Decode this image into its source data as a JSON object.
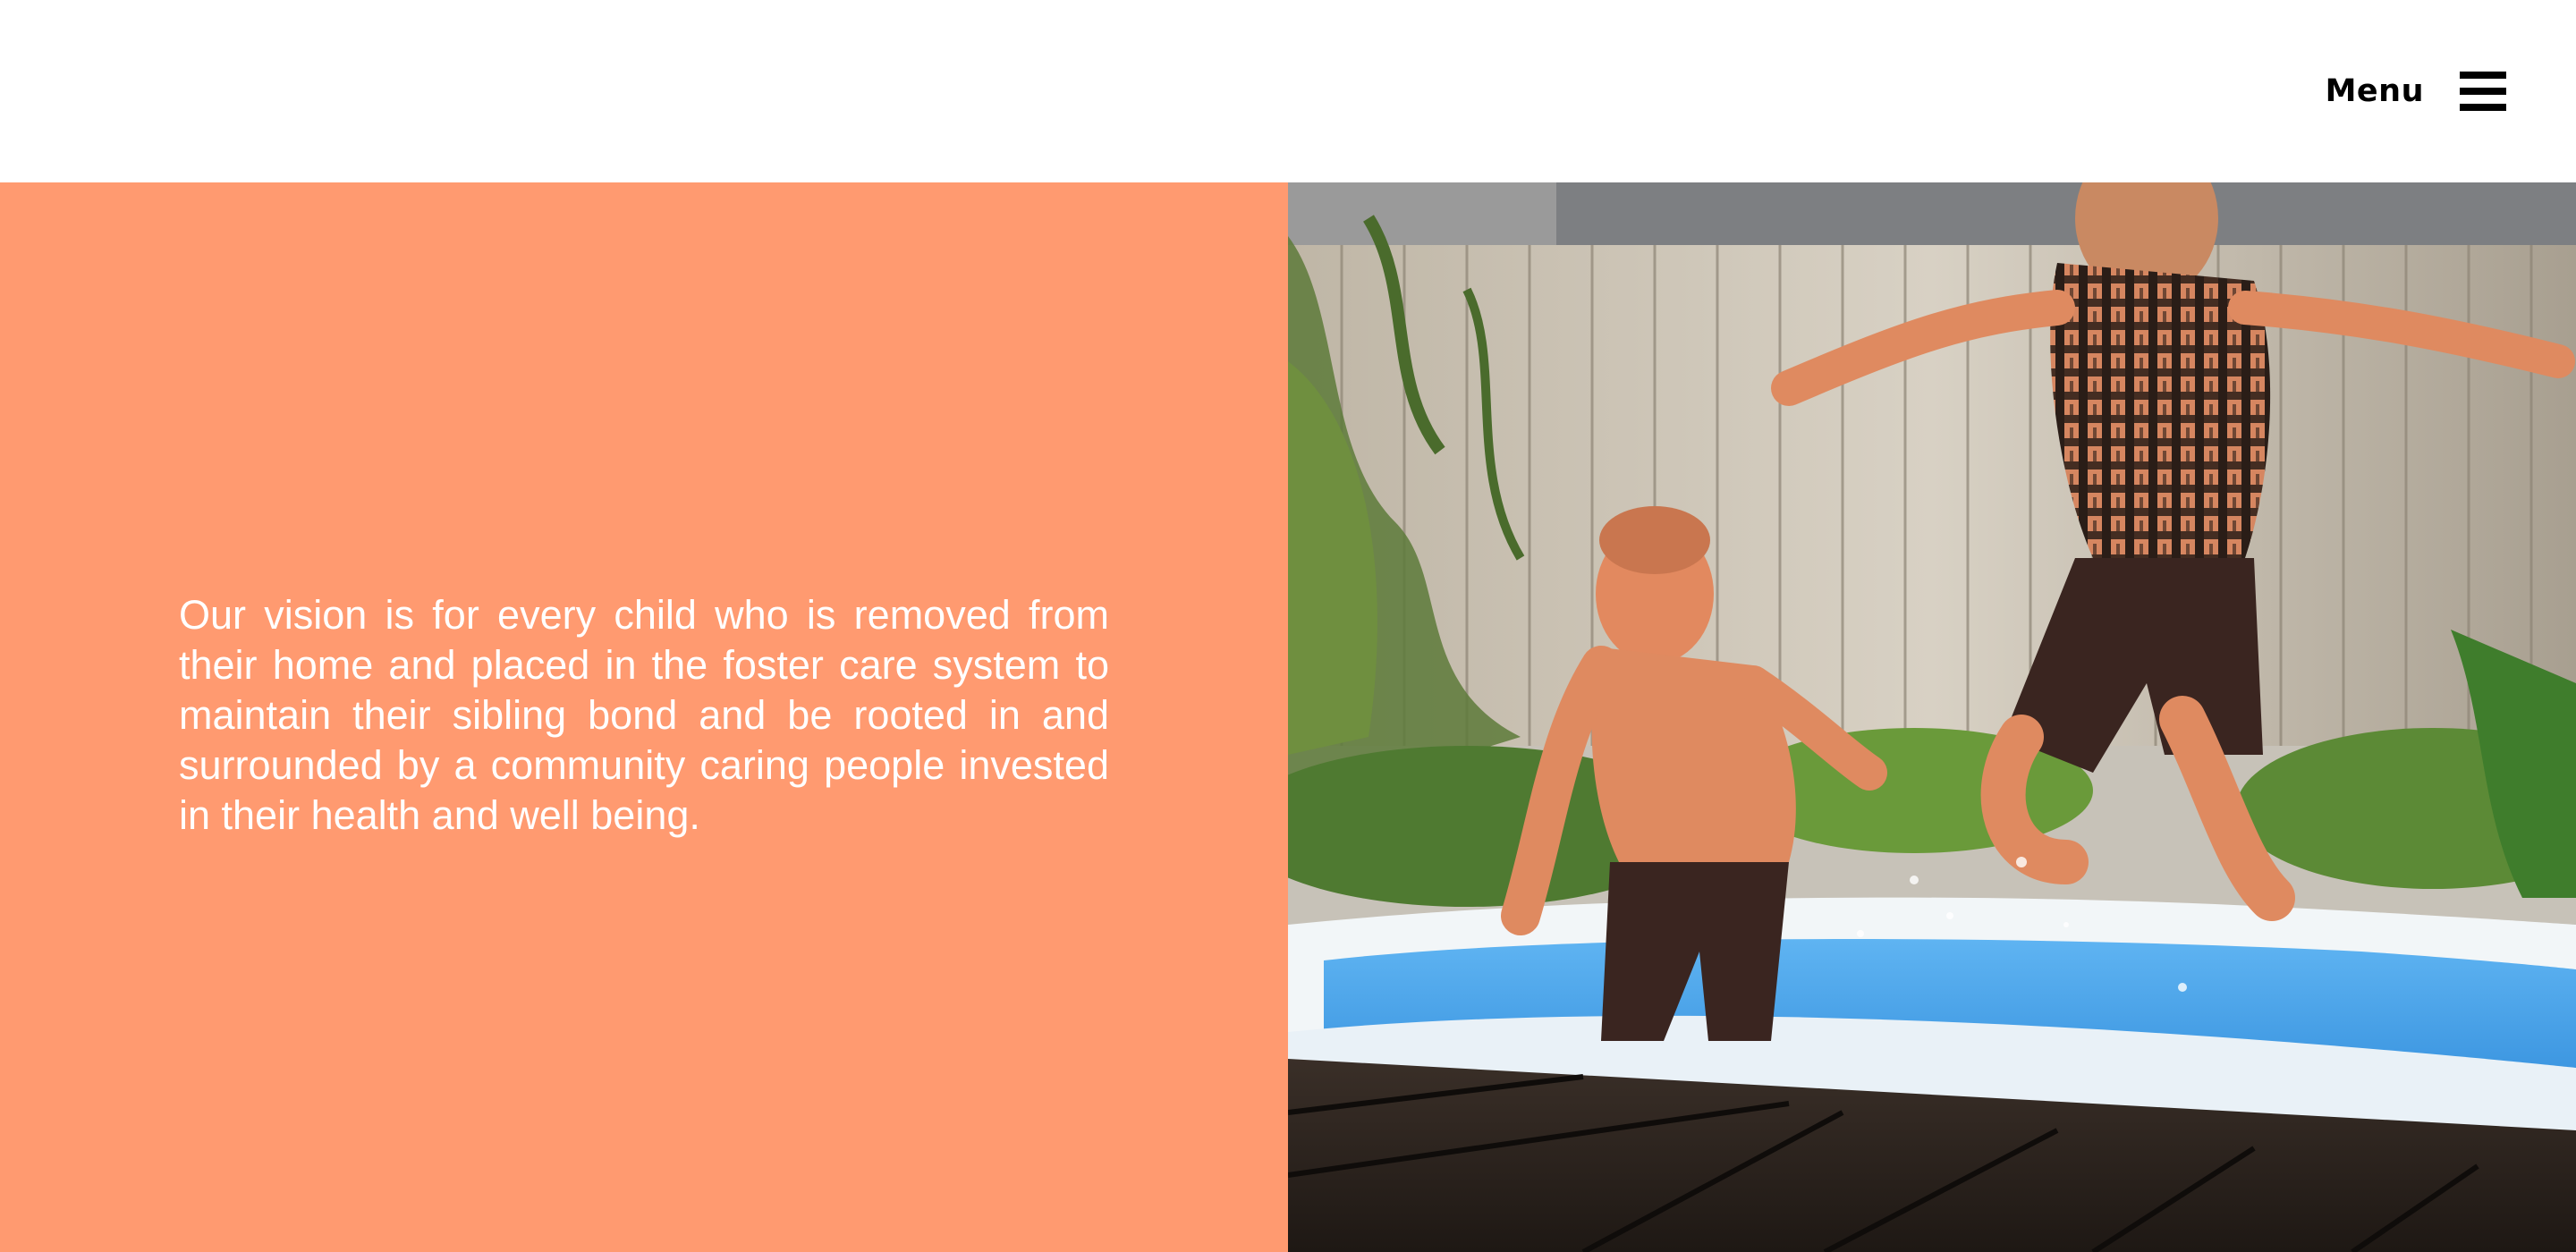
{
  "header": {
    "menu_label": "Menu",
    "menu_icon": "hamburger-icon"
  },
  "vision": {
    "text": "Our vision is for every child who is removed from their home and placed in the foster care system to maintain their sibling bond and be rooted in and surrounded by a community caring people invested in their health and well being."
  },
  "hero_image": {
    "subject": "two-boys-jumping-into-pool-photo"
  },
  "colors": {
    "accent": "#ff9a70",
    "text_on_accent": "#ffffff",
    "header_bg": "#ffffff",
    "menu_text": "#000000"
  }
}
